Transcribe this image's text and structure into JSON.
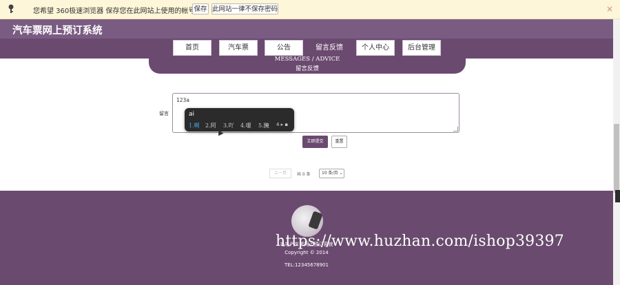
{
  "password_bar": {
    "message": "您希望 360极速浏览器 保存您在此网站上使用的帐号吗?",
    "save_label": "保存",
    "never_label": "此网站一律不保存密码",
    "close": "×"
  },
  "header": {
    "title": "汽车票网上预订系统"
  },
  "nav": {
    "items": [
      {
        "label": "首页"
      },
      {
        "label": "汽车票"
      },
      {
        "label": "公告"
      },
      {
        "label": "留言反馈"
      },
      {
        "label": "个人中心"
      },
      {
        "label": "后台管理"
      }
    ]
  },
  "section": {
    "title_en": "MESSAGES / ADVICE",
    "title_cn": "留言反馈"
  },
  "form": {
    "label": "留言",
    "value": "123a",
    "submit_label": "立即提交",
    "reset_label": "重置"
  },
  "ime": {
    "composition": "ai",
    "candidates": [
      "1.啊",
      "2.阿",
      "3.吖",
      "4.嗄",
      "5.腌"
    ],
    "pager": "4 ▸ ▪"
  },
  "pagination": {
    "prev_label": "上一页",
    "total_text": "共 0 条",
    "page_size": "10 条/页"
  },
  "footer": {
    "lines": [
      "毛毛汽车票网上预订系统",
      "Copyright © 2014",
      "TEL:12345678901"
    ]
  },
  "watermark": "https://www.huzhan.com/ishop39397",
  "colors": {
    "accent": "#6b4a70",
    "header": "#7a5c82",
    "password_bar": "#fdf6d8"
  }
}
